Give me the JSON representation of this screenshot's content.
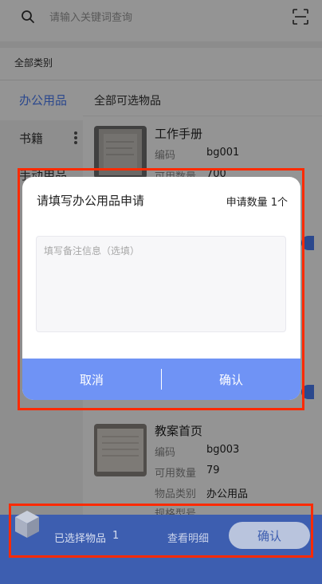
{
  "search": {
    "placeholder": "请输入关键词查询"
  },
  "category_all": "全部类别",
  "sidebar": {
    "items": [
      {
        "label": "办公用品",
        "active": true
      },
      {
        "label": "书籍",
        "active": false
      },
      {
        "label": "手动用品",
        "active": false
      }
    ]
  },
  "main": {
    "header": "全部可选物品",
    "items": [
      {
        "title": "工作手册",
        "fields": [
          {
            "key": "编码",
            "value": "bg001"
          },
          {
            "key": "可用数量",
            "value": "700"
          }
        ]
      },
      {
        "title": "教案首页",
        "fields": [
          {
            "key": "编码",
            "value": "bg003"
          },
          {
            "key": "可用数量",
            "value": "79"
          },
          {
            "key": "物品类别",
            "value": "办公用品"
          },
          {
            "key": "规格型号",
            "value": ""
          }
        ]
      }
    ]
  },
  "modal": {
    "title": "请填写办公用品申请",
    "count_label": "申请数量 1个",
    "textarea_placeholder": "填写备注信息（选填）",
    "cancel_label": "取消",
    "confirm_label": "确认"
  },
  "bottom_bar": {
    "selected_label": "已选择物品",
    "selected_count": "1",
    "view_detail": "查看明细",
    "confirm_label": "确认"
  },
  "colors": {
    "accent": "#4b7cf3",
    "modal_footer": "#6f93f5",
    "bottom_bar": "#3d5eb0",
    "annotation": "#ff2a00"
  },
  "icons": [
    "search-icon",
    "scan-icon",
    "cube-icon",
    "more-dots-icon"
  ]
}
